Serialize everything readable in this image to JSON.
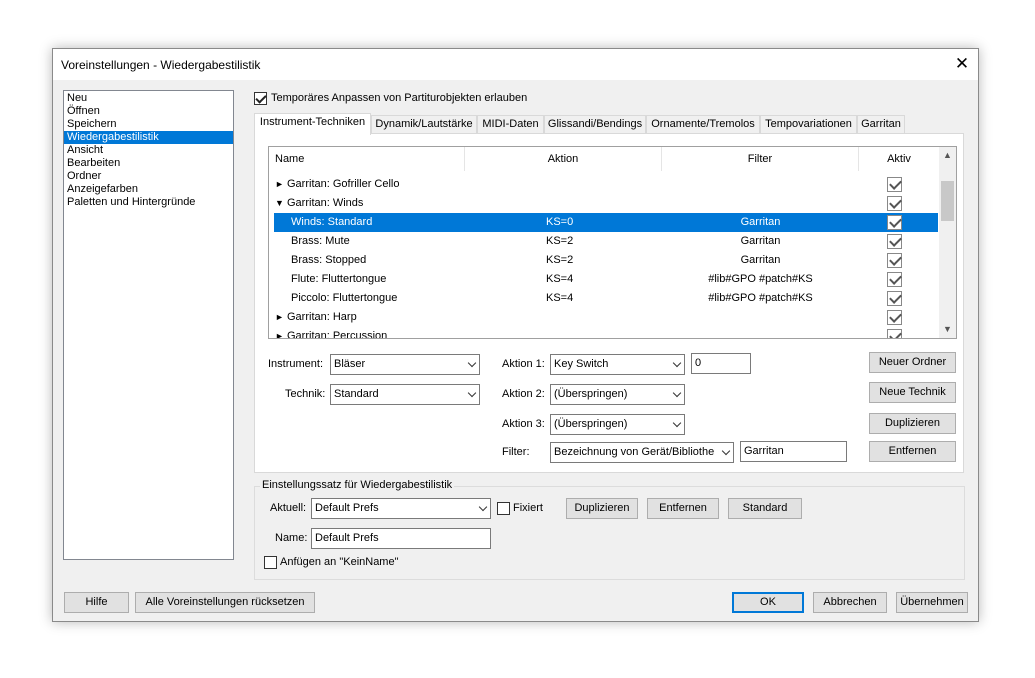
{
  "window": {
    "title": "Voreinstellungen - Wiedergabestilistik",
    "close_glyph": "✕"
  },
  "categories": [
    {
      "label": "Neu",
      "selected": false
    },
    {
      "label": "Öffnen",
      "selected": false
    },
    {
      "label": "Speichern",
      "selected": false
    },
    {
      "label": "Wiedergabestilistik",
      "selected": true
    },
    {
      "label": "Ansicht",
      "selected": false
    },
    {
      "label": "Bearbeiten",
      "selected": false
    },
    {
      "label": "Ordner",
      "selected": false
    },
    {
      "label": "Anzeigefarben",
      "selected": false
    },
    {
      "label": "Paletten und Hintergründe",
      "selected": false
    }
  ],
  "allow_temp": {
    "label": "Temporäres Anpassen von Partiturobjekten erlauben",
    "checked": true
  },
  "tabs": [
    {
      "label": "Instrument-Techniken",
      "active": true
    },
    {
      "label": "Dynamik/Lautstärke",
      "active": false
    },
    {
      "label": "MIDI-Daten",
      "active": false
    },
    {
      "label": "Glissandi/Bendings",
      "active": false
    },
    {
      "label": "Ornamente/Tremolos",
      "active": false
    },
    {
      "label": "Tempovariationen",
      "active": false
    },
    {
      "label": "Garritan",
      "active": false
    }
  ],
  "table": {
    "columns": {
      "name": "Name",
      "action": "Aktion",
      "filter": "Filter",
      "active": "Aktiv"
    },
    "rows": [
      {
        "arrow": "►",
        "name": "Garritan: Gofriller Cello",
        "action": "",
        "filter": "",
        "active": true,
        "indent": 0,
        "selected": false
      },
      {
        "arrow": "▼",
        "name": "Garritan: Winds",
        "action": "",
        "filter": "",
        "active": true,
        "indent": 0,
        "selected": false
      },
      {
        "arrow": "",
        "name": "Winds: Standard",
        "action": "KS=0",
        "filter": "Garritan",
        "active": true,
        "indent": 1,
        "selected": true
      },
      {
        "arrow": "",
        "name": "Brass: Mute",
        "action": "KS=2",
        "filter": "Garritan",
        "active": true,
        "indent": 1,
        "selected": false
      },
      {
        "arrow": "",
        "name": "Brass: Stopped",
        "action": "KS=2",
        "filter": "Garritan",
        "active": true,
        "indent": 1,
        "selected": false
      },
      {
        "arrow": "",
        "name": "Flute: Fluttertongue",
        "action": "KS=4",
        "filter": "#lib#GPO #patch#KS",
        "active": true,
        "indent": 1,
        "selected": false
      },
      {
        "arrow": "",
        "name": "Piccolo: Fluttertongue",
        "action": "KS=4",
        "filter": "#lib#GPO #patch#KS",
        "active": true,
        "indent": 1,
        "selected": false
      },
      {
        "arrow": "►",
        "name": "Garritan: Harp",
        "action": "",
        "filter": "",
        "active": true,
        "indent": 0,
        "selected": false
      },
      {
        "arrow": "►",
        "name": "Garritan: Percussion",
        "action": "",
        "filter": "",
        "active": true,
        "indent": 0,
        "selected": false
      }
    ]
  },
  "form": {
    "instrument_label": "Instrument:",
    "instrument_value": "Bläser",
    "technik_label": "Technik:",
    "technik_value": "Standard",
    "aktion1_label": "Aktion 1:",
    "aktion1_value": "Key Switch",
    "aktion1_number": "0",
    "aktion2_label": "Aktion 2:",
    "aktion2_value": "(Überspringen)",
    "aktion3_label": "Aktion 3:",
    "aktion3_value": "(Überspringen)",
    "filter_label": "Filter:",
    "filter_combo": "Bezeichnung von Gerät/Bibliothek",
    "filter_text": "Garritan"
  },
  "side_buttons": {
    "neuer_ordner": "Neuer Ordner",
    "neue_technik": "Neue Technik",
    "duplizieren": "Duplizieren",
    "entfernen": "Entfernen"
  },
  "prefset": {
    "title": "Einstellungssatz für Wiedergabestilistik",
    "aktuell_label": "Aktuell:",
    "aktuell_value": "Default Prefs",
    "fixiert_label": "Fixiert",
    "fixiert_checked": false,
    "duplizieren": "Duplizieren",
    "entfernen": "Entfernen",
    "standard": "Standard",
    "name_label": "Name:",
    "name_value": "Default Prefs",
    "append_label": "Anfügen an \"KeinName\"",
    "append_checked": false
  },
  "footer": {
    "hilfe": "Hilfe",
    "reset_all": "Alle Voreinstellungen rücksetzen",
    "ok": "OK",
    "abbrechen": "Abbrechen",
    "uebernehmen": "Übernehmen"
  },
  "colors": {
    "selection": "#0078d7",
    "dialog_bg": "#f0f0f0"
  }
}
